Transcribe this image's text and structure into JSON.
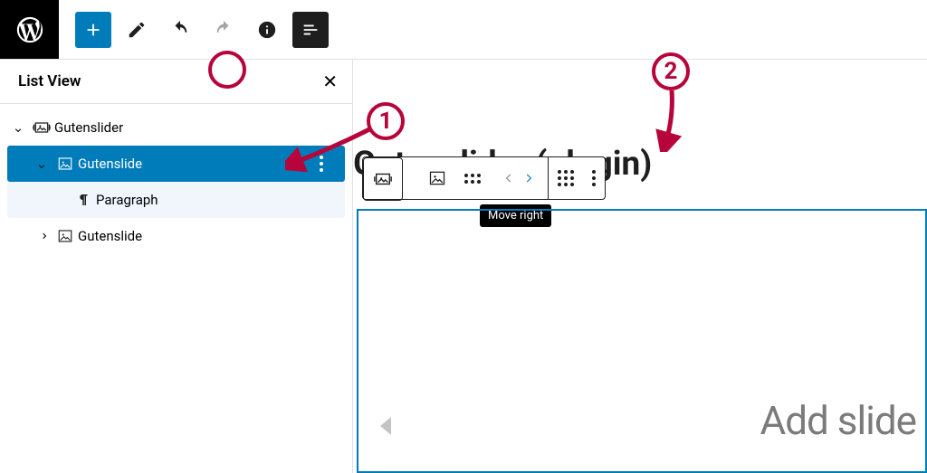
{
  "toolbar": {
    "listview_title": "List View"
  },
  "tree": {
    "root": {
      "label": "Gutenslider"
    },
    "slide1": {
      "label": "Gutenslide"
    },
    "paragraph": {
      "label": "Paragraph"
    },
    "slide2": {
      "label": "Gutenslide"
    }
  },
  "canvas": {
    "title": "Gutenslider (plugin)",
    "placeholder": "Add slide",
    "tooltip": "Move right"
  },
  "annotations": {
    "one": "1",
    "two": "2"
  }
}
